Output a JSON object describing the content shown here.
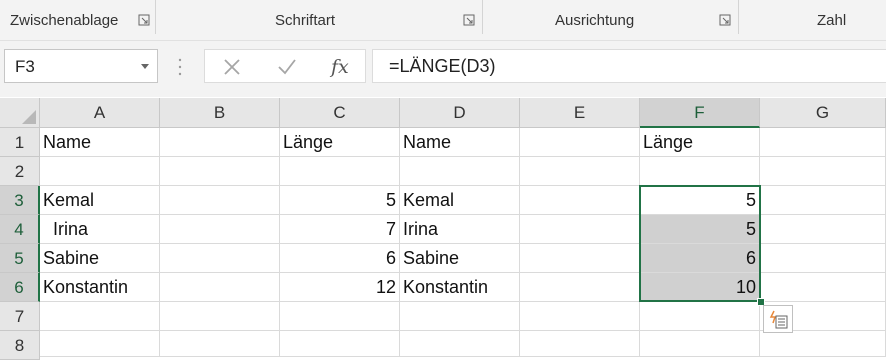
{
  "ribbon": {
    "groups": [
      {
        "label": "Zwischenablage"
      },
      {
        "label": "Schriftart"
      },
      {
        "label": "Ausrichtung"
      },
      {
        "label": "Zahl"
      }
    ]
  },
  "formula_bar": {
    "name_box": "F3",
    "formula": "=LÄNGE(D3)",
    "icons": [
      "cancel-icon",
      "enter-icon",
      "insert-function-icon"
    ],
    "fx_label": "fx"
  },
  "sheet": {
    "columns": [
      "A",
      "B",
      "C",
      "D",
      "E",
      "F",
      "G"
    ],
    "rows": [
      "1",
      "2",
      "3",
      "4",
      "5",
      "6",
      "7",
      "8"
    ],
    "selected_column": "F",
    "selected_rows": [
      "3",
      "4",
      "5",
      "6"
    ],
    "cells": {
      "A1": "Name",
      "C1": "Länge",
      "D1": "Name",
      "F1": "Länge",
      "A3": "Kemal",
      "C3": "5",
      "D3": "Kemal",
      "F3": "5",
      "A4": "  Irina",
      "C4": "7",
      "D4": "Irina",
      "F4": "5",
      "A5": "Sabine",
      "C5": "6",
      "D5": "Sabine",
      "F5": "6",
      "A6": "Konstantin",
      "C6": "12",
      "D6": "Konstantin",
      "F6": "10"
    }
  },
  "colors": {
    "accent": "#217346",
    "selection_fill": "#d0d0d0"
  }
}
